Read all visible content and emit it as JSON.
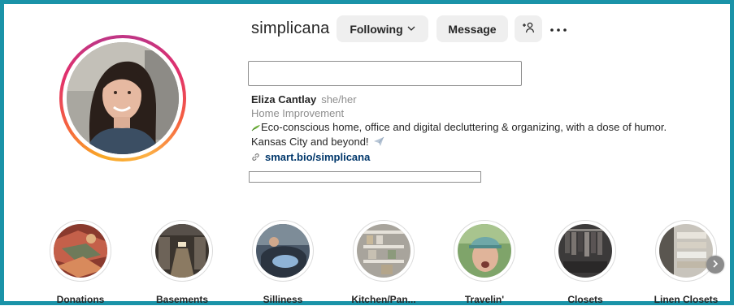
{
  "profile": {
    "username": "simplicana",
    "display_name": "Eliza Cantlay",
    "pronouns": "she/her",
    "category": "Home Improvement",
    "bio_line1": "Eco-conscious home, office and digital decluttering & organizing, with a dose of humor.",
    "bio_line2": "Kansas City and beyond!",
    "link": "smart.bio/simplicana"
  },
  "actions": {
    "following_label": "Following",
    "message_label": "Message"
  },
  "icons": {
    "following_caret": "chevron-down-icon",
    "add_user": "person-add-icon",
    "more": "more-horizontal-icon",
    "link": "link-icon",
    "bio_emoji_1": "seedling-icon",
    "bio_emoji_2": "airplane-icon",
    "next": "chevron-right-icon"
  },
  "highlights": [
    {
      "label": "Donations"
    },
    {
      "label": "Basements"
    },
    {
      "label": "Silliness"
    },
    {
      "label": "Kitchen/Pan..."
    },
    {
      "label": "Travelin'"
    },
    {
      "label": "Closets"
    },
    {
      "label": "Linen Closets"
    }
  ],
  "colors": {
    "frame_border": "#1a93a8",
    "button_bg": "#efefef",
    "link": "#00376b",
    "muted_text": "#8e8e8e"
  }
}
